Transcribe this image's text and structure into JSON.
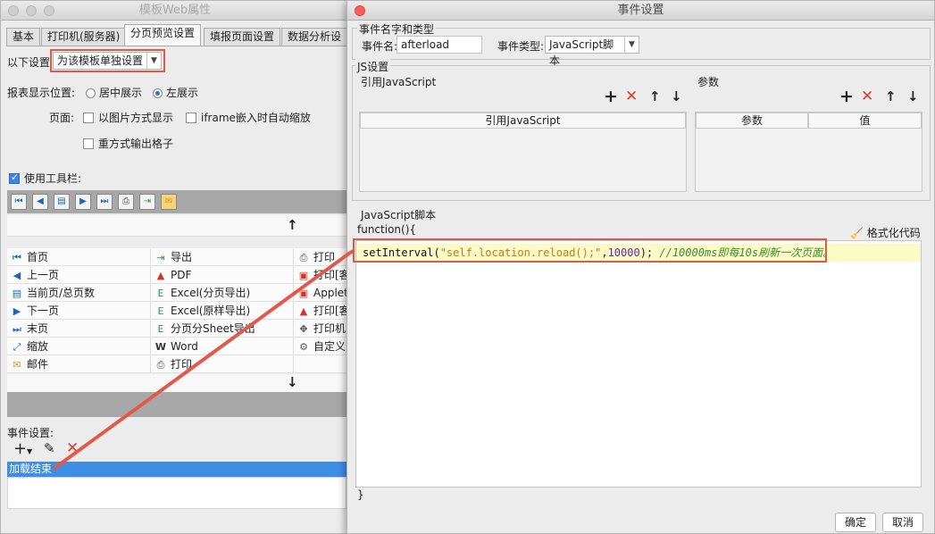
{
  "left_window": {
    "title": "模板Web属性",
    "tabs": [
      "基本",
      "打印机(服务器)",
      "分页预览设置",
      "填报页面设置",
      "数据分析设置"
    ],
    "setting_label": "以下设置",
    "setting_value": "为该模板单独设置",
    "position_label": "报表显示位置:",
    "position_options": [
      "居中展示",
      "左展示"
    ],
    "page_label": "页面:",
    "page_options": [
      "以图片方式显示",
      "iframe嵌入时自动缩放",
      "重方式输出格子"
    ],
    "toolbar_checkbox": "使用工具栏:",
    "grid": [
      [
        "首页",
        "导出",
        "打印"
      ],
      [
        "上一页",
        "PDF",
        "打印[客"
      ],
      [
        "当前页/总页数",
        "Excel(分页导出)",
        "Applet"
      ],
      [
        "下一页",
        "Excel(原样导出)",
        "打印[客"
      ],
      [
        "末页",
        "分页分Sheet导出",
        "打印机("
      ],
      [
        "缩放",
        "Word",
        "自定义‍"
      ],
      [
        "邮件",
        "打印",
        ""
      ]
    ],
    "event_label": "事件设置:",
    "event_item": "加载结束"
  },
  "right_window": {
    "title": "事件设置",
    "section_event": "事件名字和类型",
    "event_name_label": "事件名:",
    "event_name_value": "afterload",
    "event_type_label": "事件类型:",
    "event_type_value": "JavaScript脚本",
    "section_js": "JS设置",
    "ref_js_label": "引用JavaScript",
    "ref_js_header": "引用JavaScript",
    "params_label": "参数",
    "params_headers": [
      "参数",
      "值"
    ],
    "script_label": "JavaScript脚本",
    "function_open": "function(){",
    "format_code": "格式化代码",
    "code_fn": "setInterval(",
    "code_str": "\"self.location.reload();\"",
    "code_mid": ",",
    "code_num": "10000",
    "code_end": "); ",
    "code_comment": "//10000ms即每10s刷新一次页面。",
    "function_close": "}",
    "ok_button": "确定",
    "cancel_button": "取消"
  },
  "colors": {
    "annotation_red": "#e05a4a",
    "selection_blue": "#3f8ee6",
    "code_highlight": "#fbfbc8"
  }
}
